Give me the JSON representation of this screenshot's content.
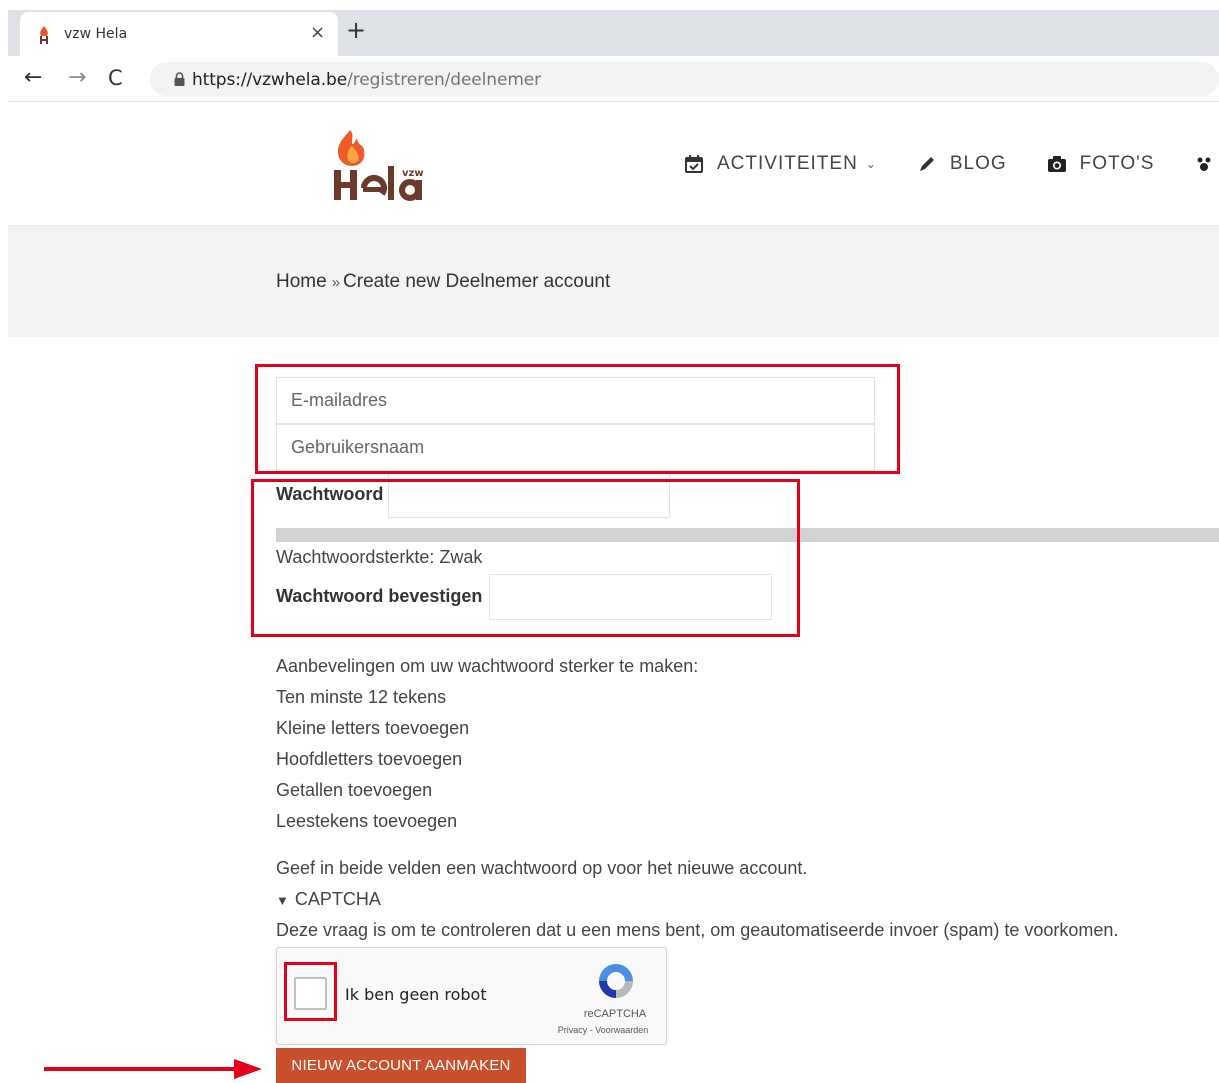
{
  "browser": {
    "tab_title": "vzw Hela",
    "tab_close": "×",
    "new_tab": "+",
    "url_host": "https://vzwhela.be",
    "url_path": "/registreren/deelnemer"
  },
  "site": {
    "logo_text": "Hela",
    "logo_suffix": "vzw",
    "nav": [
      {
        "label": "ACTIVITEITEN",
        "icon": "calendar-check-icon"
      },
      {
        "label": "BLOG",
        "icon": "pencil-icon"
      },
      {
        "label": "FOTO'S",
        "icon": "camera-icon"
      }
    ]
  },
  "breadcrumb": {
    "home": "Home",
    "separator": "»",
    "current": "Create new Deelnemer account"
  },
  "form": {
    "email_placeholder": "E-mailadres",
    "username_placeholder": "Gebruikersnaam",
    "password_label": "Wachtwoord",
    "strength_text": "Wachtwoordsterkte: Zwak",
    "confirm_label": "Wachtwoord bevestigen",
    "recommendations_title": "Aanbevelingen om uw wachtwoord sterker te maken:",
    "recommendations": [
      "Ten minste 12 tekens",
      "Kleine letters toevoegen",
      "Hoofdletters toevoegen",
      "Getallen toevoegen",
      "Leestekens toevoegen"
    ],
    "password_help": "Geef in beide velden een wachtwoord op voor het nieuwe account.",
    "captcha_toggle": "CAPTCHA",
    "captcha_description": "Deze vraag is om te controleren dat u een mens bent, om geautomatiseerde invoer (spam) te voorkomen.",
    "recaptcha": {
      "checkbox_label": "Ik ben geen robot",
      "brand": "reCAPTCHA",
      "links": "Privacy - Voorwaarden"
    },
    "submit_label": "NIEUW ACCOUNT AANMAKEN"
  },
  "colors": {
    "accent": "#c8502d",
    "highlight": "#e3001b"
  }
}
